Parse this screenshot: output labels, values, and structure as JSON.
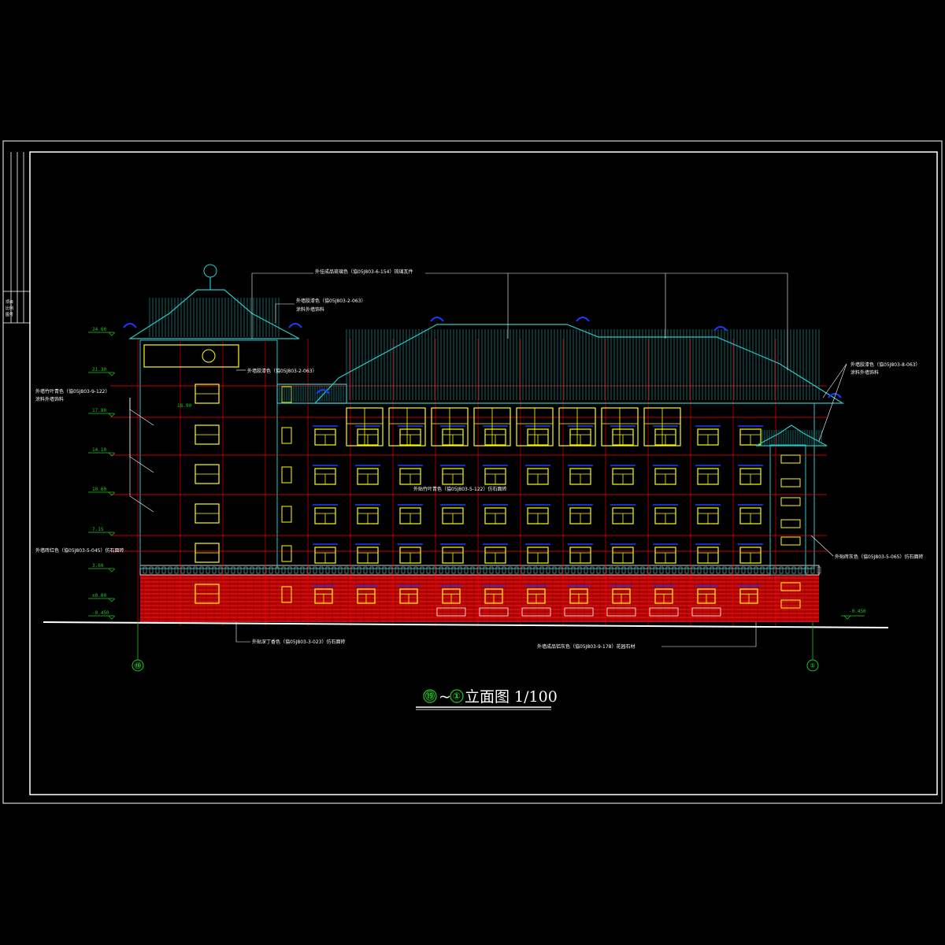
{
  "drawing": {
    "title_axis_from": "⑲",
    "title_separator": "~",
    "title_axis_to": "①",
    "title_text": "立面图 1/100"
  },
  "title_block": {
    "cells": [
      "项目",
      "比例",
      "图号"
    ]
  },
  "levels": [
    {
      "value": "24.60"
    },
    {
      "value": "21.30"
    },
    {
      "value": "17.80"
    },
    {
      "value": "14.10"
    },
    {
      "value": "10.60"
    },
    {
      "value": "7.15"
    },
    {
      "value": "3.60"
    },
    {
      "value": "±0.00"
    },
    {
      "value": "-0.450"
    }
  ],
  "levels_right": {
    "ground": "-0.450"
  },
  "level_mid": "18.90",
  "notes": {
    "roof_tile": "外挂成品琉璃色（協05J803-6-154）琉璃瓦件",
    "eave_left": "外墙胶漆色（協05J803-2-063）",
    "eave_left_2": "涂料外墙饰料",
    "window_band": "外墙胶漆色（協05J803-2-063）",
    "wall_left": "外墙竹叶青色（協05J803-9-122）",
    "wall_left_2": "涂料外墙饰料",
    "base_left": "外墙砖红色（協05J803-5-045）仿石面砖",
    "center_band": "外贴竹叶青色（協05J803-5-122）仿石面砖",
    "eave_right": "外墙胶漆色（協05J803-8-063）",
    "eave_right_2": "涂料外墙饰料",
    "wall_right": "外贴砖灰色（協05J803-5-065）仿石面砖",
    "bottom_left": "外贴深丁香色（協05J803-3-023）仿石面砖",
    "bottom_right": "外墙成品铝灰色（協05J803-9-178）花园石材"
  },
  "axes": {
    "left": "⑲",
    "right": "①"
  },
  "colors": {
    "frame": "#ffffff",
    "roof": "#2ac8c8",
    "grid": "#ff0000",
    "window": "#ffff00",
    "brick": "#b40000",
    "text_green": "#1ec81e",
    "dark_blue": "#1e3cff"
  }
}
